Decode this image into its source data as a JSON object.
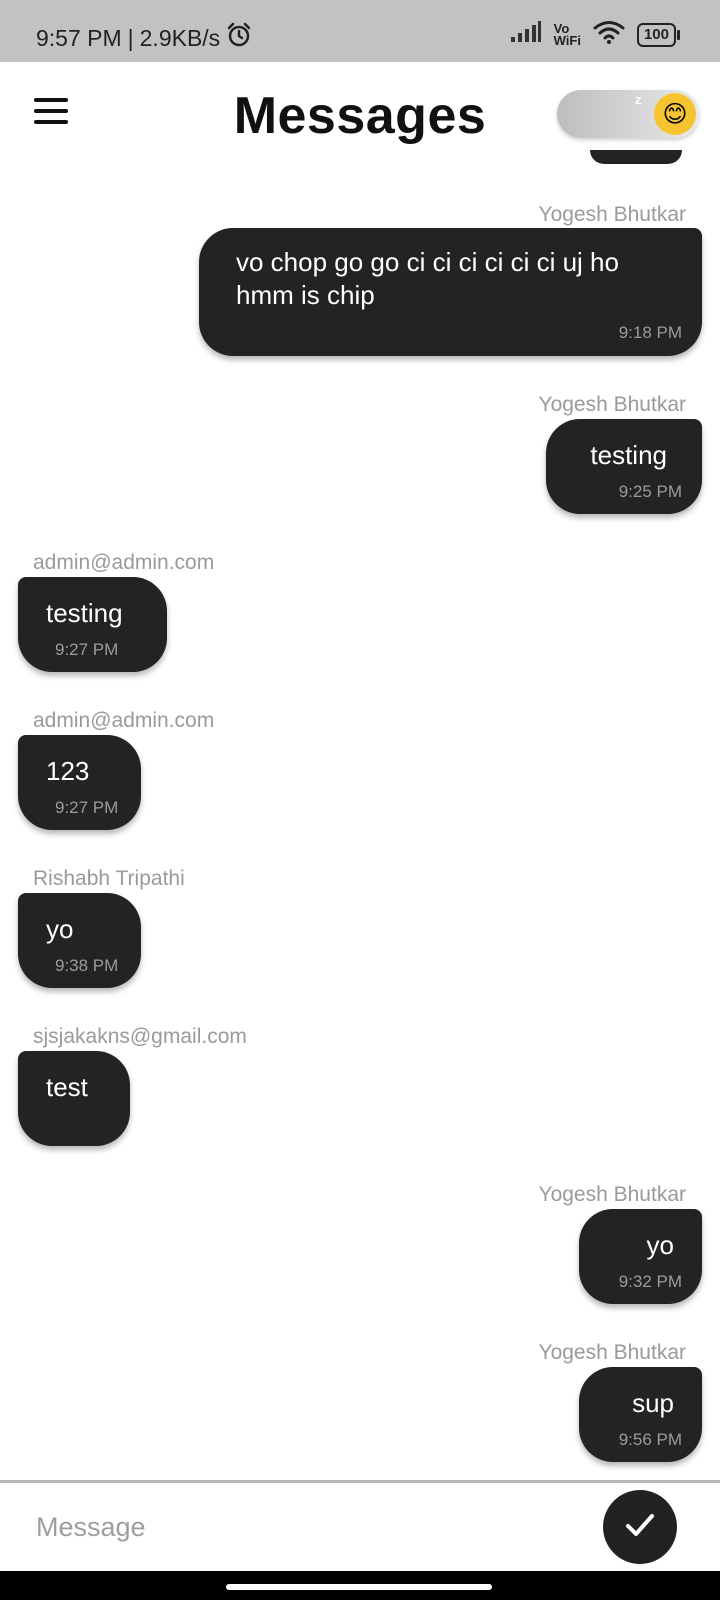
{
  "status_bar": {
    "time": "9:57 PM",
    "separator": "|",
    "speed": "2.9KB/s",
    "alarm_icon": "alarm-icon",
    "vowifi_top": "Vo",
    "vowifi_bottom": "WiFi",
    "battery": "100"
  },
  "header": {
    "title": "Messages",
    "menu_icon": "hamburger-menu-icon",
    "toggle_emoji": "😊",
    "toggle_zz": "z"
  },
  "messages": [
    {
      "sender": "Yogesh Bhutkar",
      "text_line1": "vo chop go go ci ci ci ci ci ci uj ho",
      "text_line2": "hmm is chip",
      "time": "9:18 PM",
      "direction": "out"
    },
    {
      "sender": "Yogesh Bhutkar",
      "text": "testing",
      "time": "9:25 PM",
      "direction": "out"
    },
    {
      "sender": "admin@admin.com",
      "text": "testing",
      "time": "9:27 PM",
      "direction": "in"
    },
    {
      "sender": "admin@admin.com",
      "text": "123",
      "time": "9:27 PM",
      "direction": "in"
    },
    {
      "sender": "Rishabh Tripathi",
      "text": "yo",
      "time": "9:38 PM",
      "direction": "in"
    },
    {
      "sender": "sjsjakakns@gmail.com",
      "text": "test",
      "time": "",
      "direction": "in"
    },
    {
      "sender": "Yogesh Bhutkar",
      "text": "yo",
      "time": "9:32 PM",
      "direction": "out"
    },
    {
      "sender": "Yogesh Bhutkar",
      "text": "sup",
      "time": "9:56 PM",
      "direction": "out"
    }
  ],
  "input": {
    "placeholder": "Message",
    "value": "",
    "send_icon": "checkmark-icon"
  },
  "colors": {
    "bubble": "#232323",
    "status_bar": "#c2c2c2",
    "sender_text": "#9a9a9a"
  }
}
